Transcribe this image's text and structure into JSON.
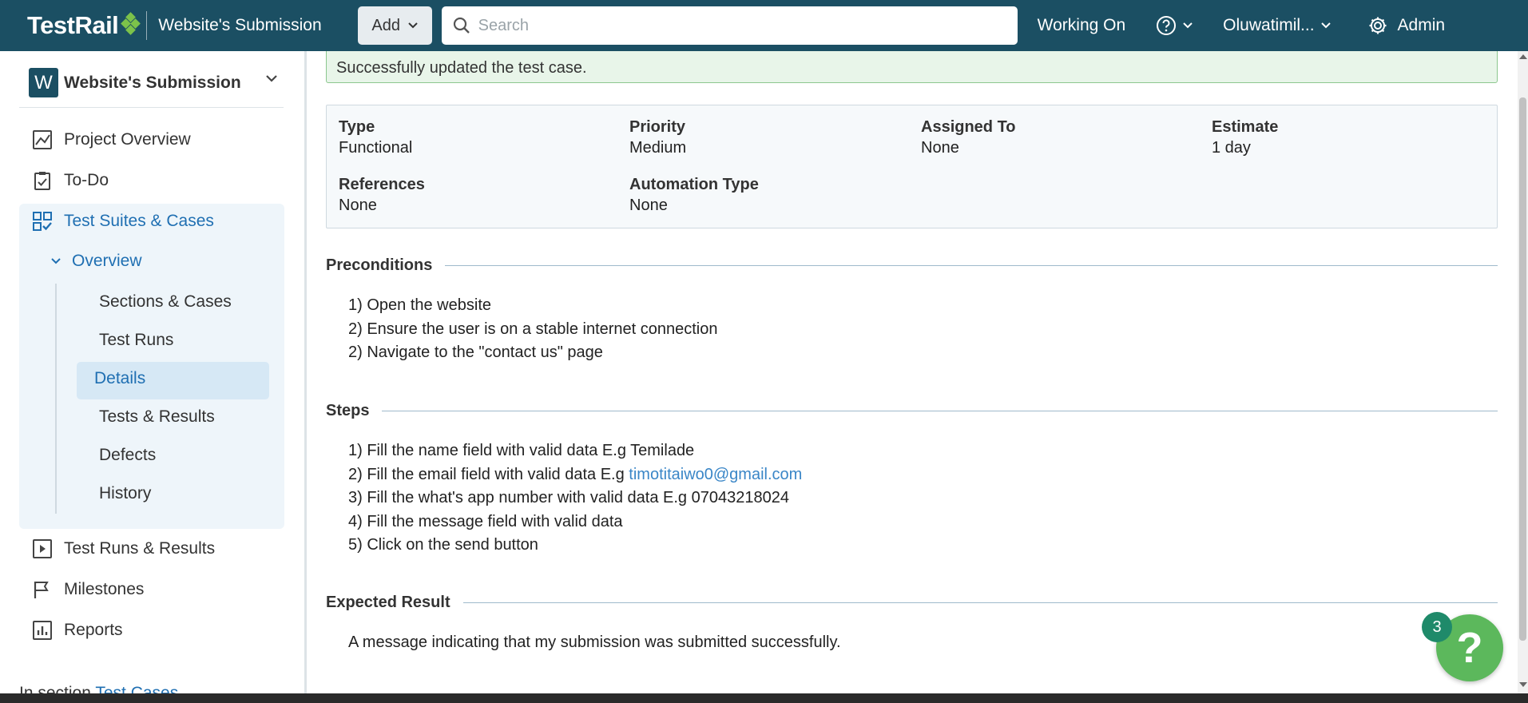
{
  "header": {
    "logo": "TestRail",
    "project_title": "Website's Submission",
    "add_label": "Add",
    "search_placeholder": "Search",
    "working_on": "Working On",
    "user_name": "Oluwatimil...",
    "admin_label": "Admin"
  },
  "sidebar": {
    "project_initial": "W",
    "project_name": "Website's Submission",
    "nav": {
      "project_overview": "Project Overview",
      "todo": "To-Do",
      "test_suites": "Test Suites & Cases",
      "overview": "Overview",
      "test_runs_results": "Test Runs & Results",
      "milestones": "Milestones",
      "reports": "Reports"
    },
    "sub_items": {
      "sections_cases": "Sections & Cases",
      "test_runs": "Test Runs",
      "details": "Details",
      "tests_results": "Tests & Results",
      "defects": "Defects",
      "history": "History"
    },
    "section_prefix": "In section",
    "section_link": "Test Cases"
  },
  "main": {
    "success_message": "Successfully updated the test case.",
    "fields": {
      "type_label": "Type",
      "type_value": "Functional",
      "priority_label": "Priority",
      "priority_value": "Medium",
      "assigned_label": "Assigned To",
      "assigned_value": "None",
      "estimate_label": "Estimate",
      "estimate_value": "1 day",
      "references_label": "References",
      "references_value": "None",
      "automation_label": "Automation Type",
      "automation_value": "None"
    },
    "preconditions": {
      "title": "Preconditions",
      "lines": [
        "1) Open the website",
        "2) Ensure the user is on a stable internet connection",
        "2) Navigate to the \"contact us\" page"
      ]
    },
    "steps": {
      "title": "Steps",
      "line1": "1) Fill the name field with valid data E.g Temilade",
      "line2_prefix": "2) Fill the email field with valid data E.g ",
      "line2_email": "timotitaiwo0@gmail.com",
      "line3": "3) Fill the what's app number with valid data E.g 07043218024",
      "line4": "4) Fill the message field with valid data",
      "line5": "5) Click on the send button"
    },
    "expected": {
      "title": "Expected Result",
      "text": "A message indicating that my submission was submitted successfully."
    }
  },
  "help": {
    "badge_count": "3",
    "symbol": "?"
  },
  "colors": {
    "topbar": "#1b4f63",
    "accent_blue": "#1f6fb2",
    "success_bg": "#e8f5e9",
    "help_green": "#5cb85c"
  }
}
